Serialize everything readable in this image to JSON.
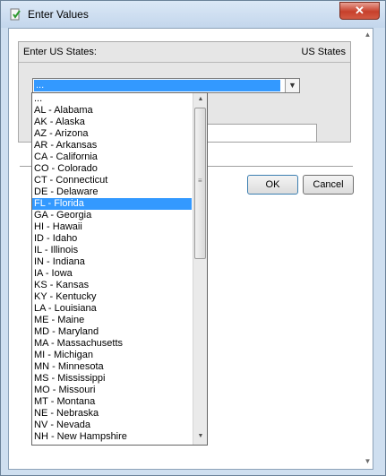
{
  "window": {
    "title": "Enter Values",
    "close_label": "✕"
  },
  "panel": {
    "label": "Enter US States:",
    "type": "US States"
  },
  "combo": {
    "value": "..."
  },
  "buttons": {
    "ok": "OK",
    "cancel": "Cancel"
  },
  "list": {
    "selected_index": 9,
    "items": [
      "...",
      "AL - Alabama",
      "AK - Alaska",
      "AZ - Arizona",
      "AR - Arkansas",
      "CA - California",
      "CO - Colorado",
      "CT - Connecticut",
      "DE - Delaware",
      "FL - Florida",
      "GA - Georgia",
      "HI - Hawaii",
      "ID - Idaho",
      "IL - Illinois",
      "IN - Indiana",
      "IA - Iowa",
      "KS - Kansas",
      "KY - Kentucky",
      "LA - Louisiana",
      "ME - Maine",
      "MD - Maryland",
      "MA - Massachusetts",
      "MI - Michigan",
      "MN - Minnesota",
      "MS - Mississippi",
      "MO - Missouri",
      "MT - Montana",
      "NE - Nebraska",
      "NV - Nevada",
      "NH - New Hampshire"
    ]
  }
}
